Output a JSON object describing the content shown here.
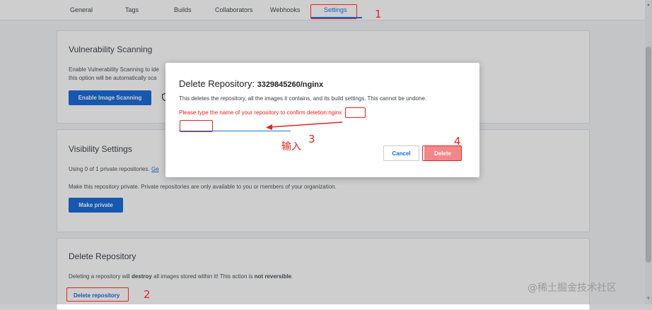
{
  "tabs": [
    {
      "label": "General"
    },
    {
      "label": "Tags"
    },
    {
      "label": "Builds"
    },
    {
      "label": "Collaborators"
    },
    {
      "label": "Webhooks"
    },
    {
      "label": "Settings"
    }
  ],
  "vulnerability": {
    "title": "Vulnerability Scanning",
    "text1": "Enable Vulnerability Scanning to ide",
    "text2": "this option will be automatically sca",
    "button": "Enable Image Scanning"
  },
  "visibility": {
    "title": "Visibility Settings",
    "usage_prefix": "Using 0 of 1 private repositories.",
    "usage_link": "Ge",
    "description": "Make this repository private. Private repositories are only available to you or members of your organization.",
    "button": "Make private"
  },
  "delete_section": {
    "title": "Delete Repository",
    "text_prefix": "Deleting a repository will ",
    "text_bold1": "destroy",
    "text_mid": " all images stored within it! This action is ",
    "text_bold2": "not reversible",
    "text_end": ".",
    "button": "Delete repository"
  },
  "modal": {
    "title": "Delete Repository:",
    "repo_name": "3329845260/nginx",
    "description": "This deletes the repository, all the images it contains, and its build settings. This cannot be undone.",
    "warning": "Please type the name of your repository to confirm deletion:",
    "confirm_name": "nginx",
    "input_value": "",
    "cancel": "Cancel",
    "delete": "Delete"
  },
  "annotations": {
    "n1": "1",
    "n2": "2",
    "n3": "3",
    "n4": "4",
    "input_hint": "输入"
  },
  "watermark": "@稀土掘金技术社区",
  "colors": {
    "accent": "#1468d8",
    "annotation_red": "#e8241c",
    "delete_disabled": "#f2878a"
  }
}
